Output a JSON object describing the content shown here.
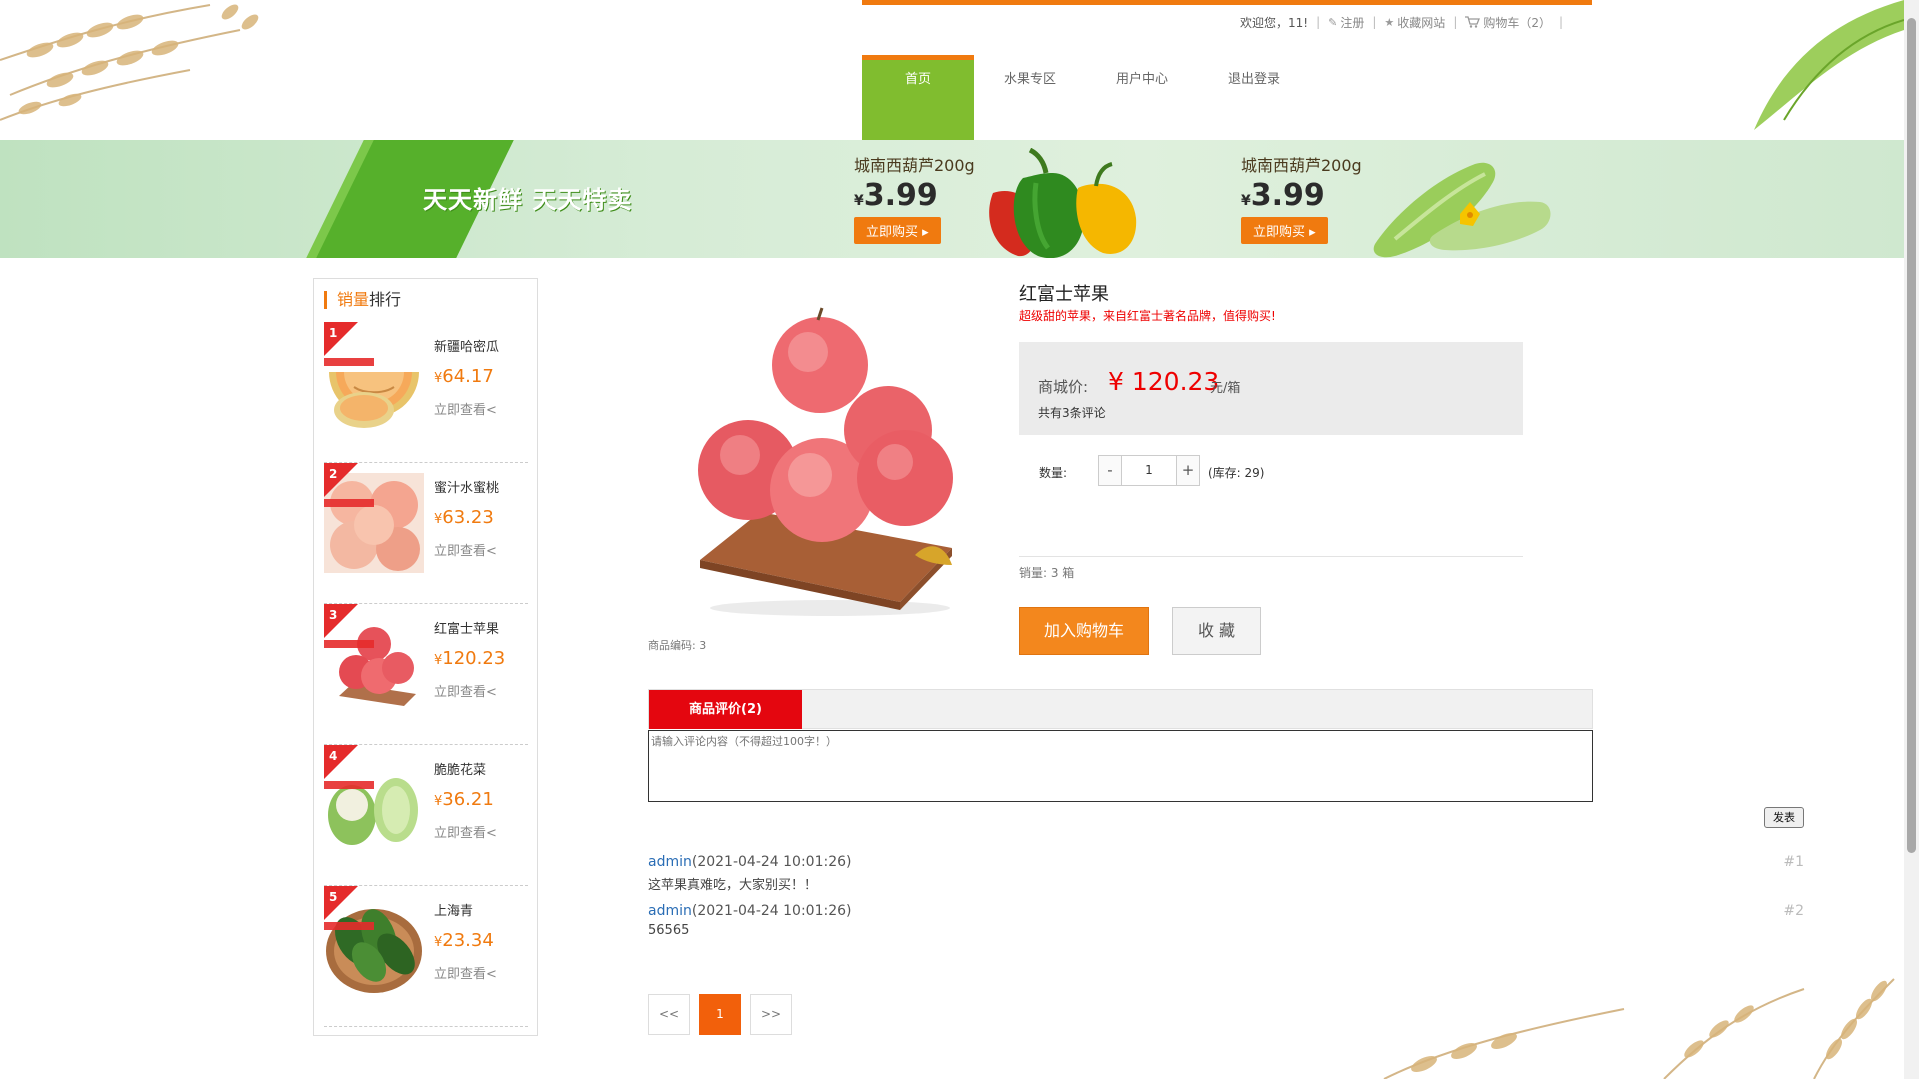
{
  "header": {
    "welcome": "欢迎您，11!",
    "register": "注册",
    "favorite_site": "收藏网站",
    "cart": "购物车（2）",
    "nav": [
      "首页",
      "水果专区",
      "用户中心",
      "退出登录"
    ]
  },
  "banner": {
    "slogan": "天天新鲜  天天特卖",
    "promos": [
      {
        "name": "城南西葫芦200g",
        "currency": "¥",
        "price": "3.99",
        "button": "立即购买 ▸"
      },
      {
        "name": "城南西葫芦200g",
        "currency": "¥",
        "price": "3.99",
        "button": "立即购买 ▸"
      }
    ]
  },
  "sidebar": {
    "title_highlight": "销量",
    "title_rest": "排行",
    "items": [
      {
        "rank": "1",
        "name": "新疆哈密瓜",
        "currency": "¥",
        "price": "64.17",
        "link": "立即查看<"
      },
      {
        "rank": "2",
        "name": "蜜汁水蜜桃",
        "currency": "¥",
        "price": "63.23",
        "link": "立即查看<"
      },
      {
        "rank": "3",
        "name": "红富士苹果",
        "currency": "¥",
        "price": "120.23",
        "link": "立即查看<"
      },
      {
        "rank": "4",
        "name": "脆脆花菜",
        "currency": "¥",
        "price": "36.21",
        "link": "立即查看<"
      },
      {
        "rank": "5",
        "name": "上海青",
        "currency": "¥",
        "price": "23.34",
        "link": "立即查看<"
      }
    ]
  },
  "product": {
    "title": "红富士苹果",
    "subtitle": "超级甜的苹果，来自红富士著名品牌，值得购买!",
    "price_label": "商城价:",
    "price": "¥ 120.23",
    "unit": "元/箱",
    "review_count": "共有3条评论",
    "qty_label": "数量:",
    "qty_minus": "-",
    "qty_value": "1",
    "qty_plus": "+",
    "stock": "(库存: 29)",
    "sales": "销量: 3 箱",
    "add_to_cart": "加入购物车",
    "favorite": "收 藏",
    "code": "商品编码: 3"
  },
  "reviews": {
    "tab_label": "商品评价(2)",
    "input_placeholder": "请输入评论内容（不得超过100字！）",
    "post_button": "发表",
    "items": [
      {
        "user": "admin",
        "time": "(2021-04-24 10:01:26)",
        "body": "这苹果真难吃，大家别买！！",
        "index": "#1"
      },
      {
        "user": "admin",
        "time": "(2021-04-24 10:01:26)",
        "body": "56565",
        "index": "#2"
      }
    ],
    "pager": {
      "prev": "<<",
      "current": "1",
      "next": ">>"
    }
  },
  "colors": {
    "accent_orange": "#f07a0f",
    "nav_green": "#80bd2f",
    "tab_red": "#e4060f",
    "price_red": "#e00000"
  }
}
